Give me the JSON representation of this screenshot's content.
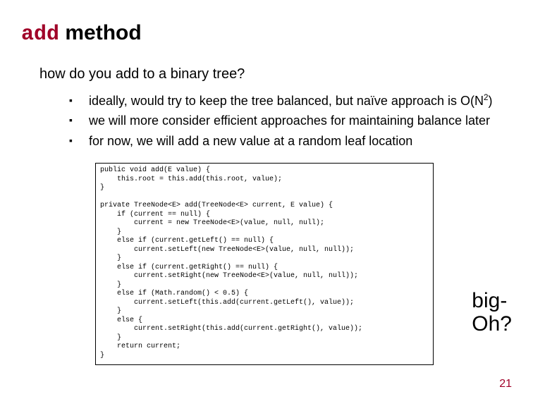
{
  "title_code": "add",
  "title_rest": " method",
  "subtitle": "how do you add to a binary tree?",
  "bullets": {
    "b1_pre": "ideally, would try to keep the tree balanced, but naïve approach is O(N",
    "b1_sup": "2",
    "b1_post": ")",
    "b2": "we will more consider efficient approaches for maintaining balance later",
    "b3": "for now, we will add a new value at a random leaf location"
  },
  "code": "public void add(E value) {\n    this.root = this.add(this.root, value);\n}\n\nprivate TreeNode<E> add(TreeNode<E> current, E value) {\n    if (current == null) {\n        current = new TreeNode<E>(value, null, null);\n    }\n    else if (current.getLeft() == null) {\n        current.setLeft(new TreeNode<E>(value, null, null));\n    }\n    else if (current.getRight() == null) {\n        current.setRight(new TreeNode<E>(value, null, null));\n    }\n    else if (Math.random() < 0.5) {\n        current.setLeft(this.add(current.getLeft(), value));\n    }\n    else {\n        current.setRight(this.add(current.getRight(), value));\n    }\n    return current;\n}",
  "bigoh_line1": "big-",
  "bigoh_line2": "Oh?",
  "pagenum": "21"
}
